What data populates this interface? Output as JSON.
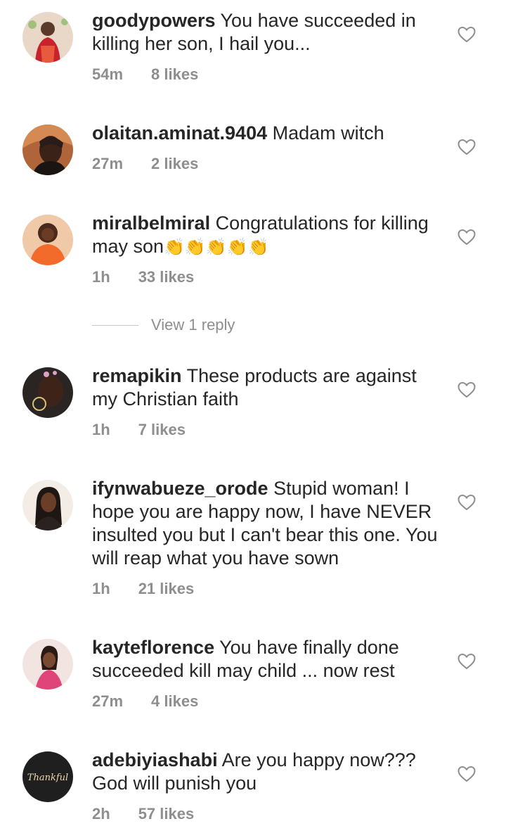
{
  "comments": [
    {
      "username": "goodypowers",
      "text": "You have succeeded in killing her son, I hail you...",
      "time": "54m",
      "likes": "8 likes",
      "avatar": "avatar-red-dress"
    },
    {
      "username": "olaitan.aminat.9404",
      "text": "Madam witch",
      "time": "27m",
      "likes": "2 likes",
      "avatar": "avatar-dark-portrait"
    },
    {
      "username": "miralbelmiral",
      "text": "Congratulations for killing may son",
      "emoji": "👏👏👏👏👏",
      "time": "1h",
      "likes": "33 likes",
      "avatar": "avatar-orange-top"
    },
    {
      "username": "remapikin",
      "text": "These products are against my Christian faith",
      "time": "1h",
      "likes": "7 likes",
      "avatar": "avatar-hoop-earring"
    },
    {
      "username": "ifynwabueze_orode",
      "text": "Stupid woman! I hope you are happy now, I have NEVER insulted you but I can't bear this one. You will reap what you have sown",
      "time": "1h",
      "likes": "21 likes",
      "avatar": "avatar-light-background"
    },
    {
      "username": "kayteflorence",
      "text": "You have finally done succeeded kill may child ... now rest",
      "time": "27m",
      "likes": "4 likes",
      "avatar": "avatar-pink-outfit"
    },
    {
      "username": "adebiyiashabi",
      "text": "Are you happy now??? God will punish you",
      "time": "2h",
      "likes": "57 likes",
      "avatar": "avatar-thankful-text",
      "avatar_text": "Thankful"
    }
  ],
  "view_replies": "View 1 reply",
  "colors": {
    "text": "#262626",
    "meta": "#8e8e8e",
    "divider": "#c7c7c7",
    "background": "#ffffff"
  },
  "icons": {
    "like": "heart-outline-icon"
  }
}
